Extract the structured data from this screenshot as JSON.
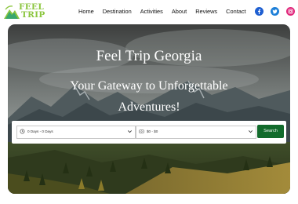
{
  "brand": {
    "line1": "FEEL",
    "line2": "TRIP",
    "color": "#8cc63f",
    "icon": "mountain-logo-icon"
  },
  "nav": {
    "items": [
      {
        "label": "Home"
      },
      {
        "label": "Destination"
      },
      {
        "label": "Activities"
      },
      {
        "label": "About"
      },
      {
        "label": "Reviews"
      },
      {
        "label": "Contact"
      }
    ]
  },
  "social": [
    {
      "icon": "facebook-icon",
      "color": "#1f5fd1"
    },
    {
      "icon": "twitter-icon",
      "color": "#1d7fd8"
    },
    {
      "icon": "instagram-icon",
      "color": "#e0257a"
    }
  ],
  "hero": {
    "title": "Feel Trip Georgia",
    "subtitle": "Your Gateway to Unforgettable Adventures!"
  },
  "search": {
    "days_value": "0 Days - 0 Days",
    "price_value": "$0 - $0",
    "button_label": "Search",
    "button_color": "#126b2c"
  }
}
